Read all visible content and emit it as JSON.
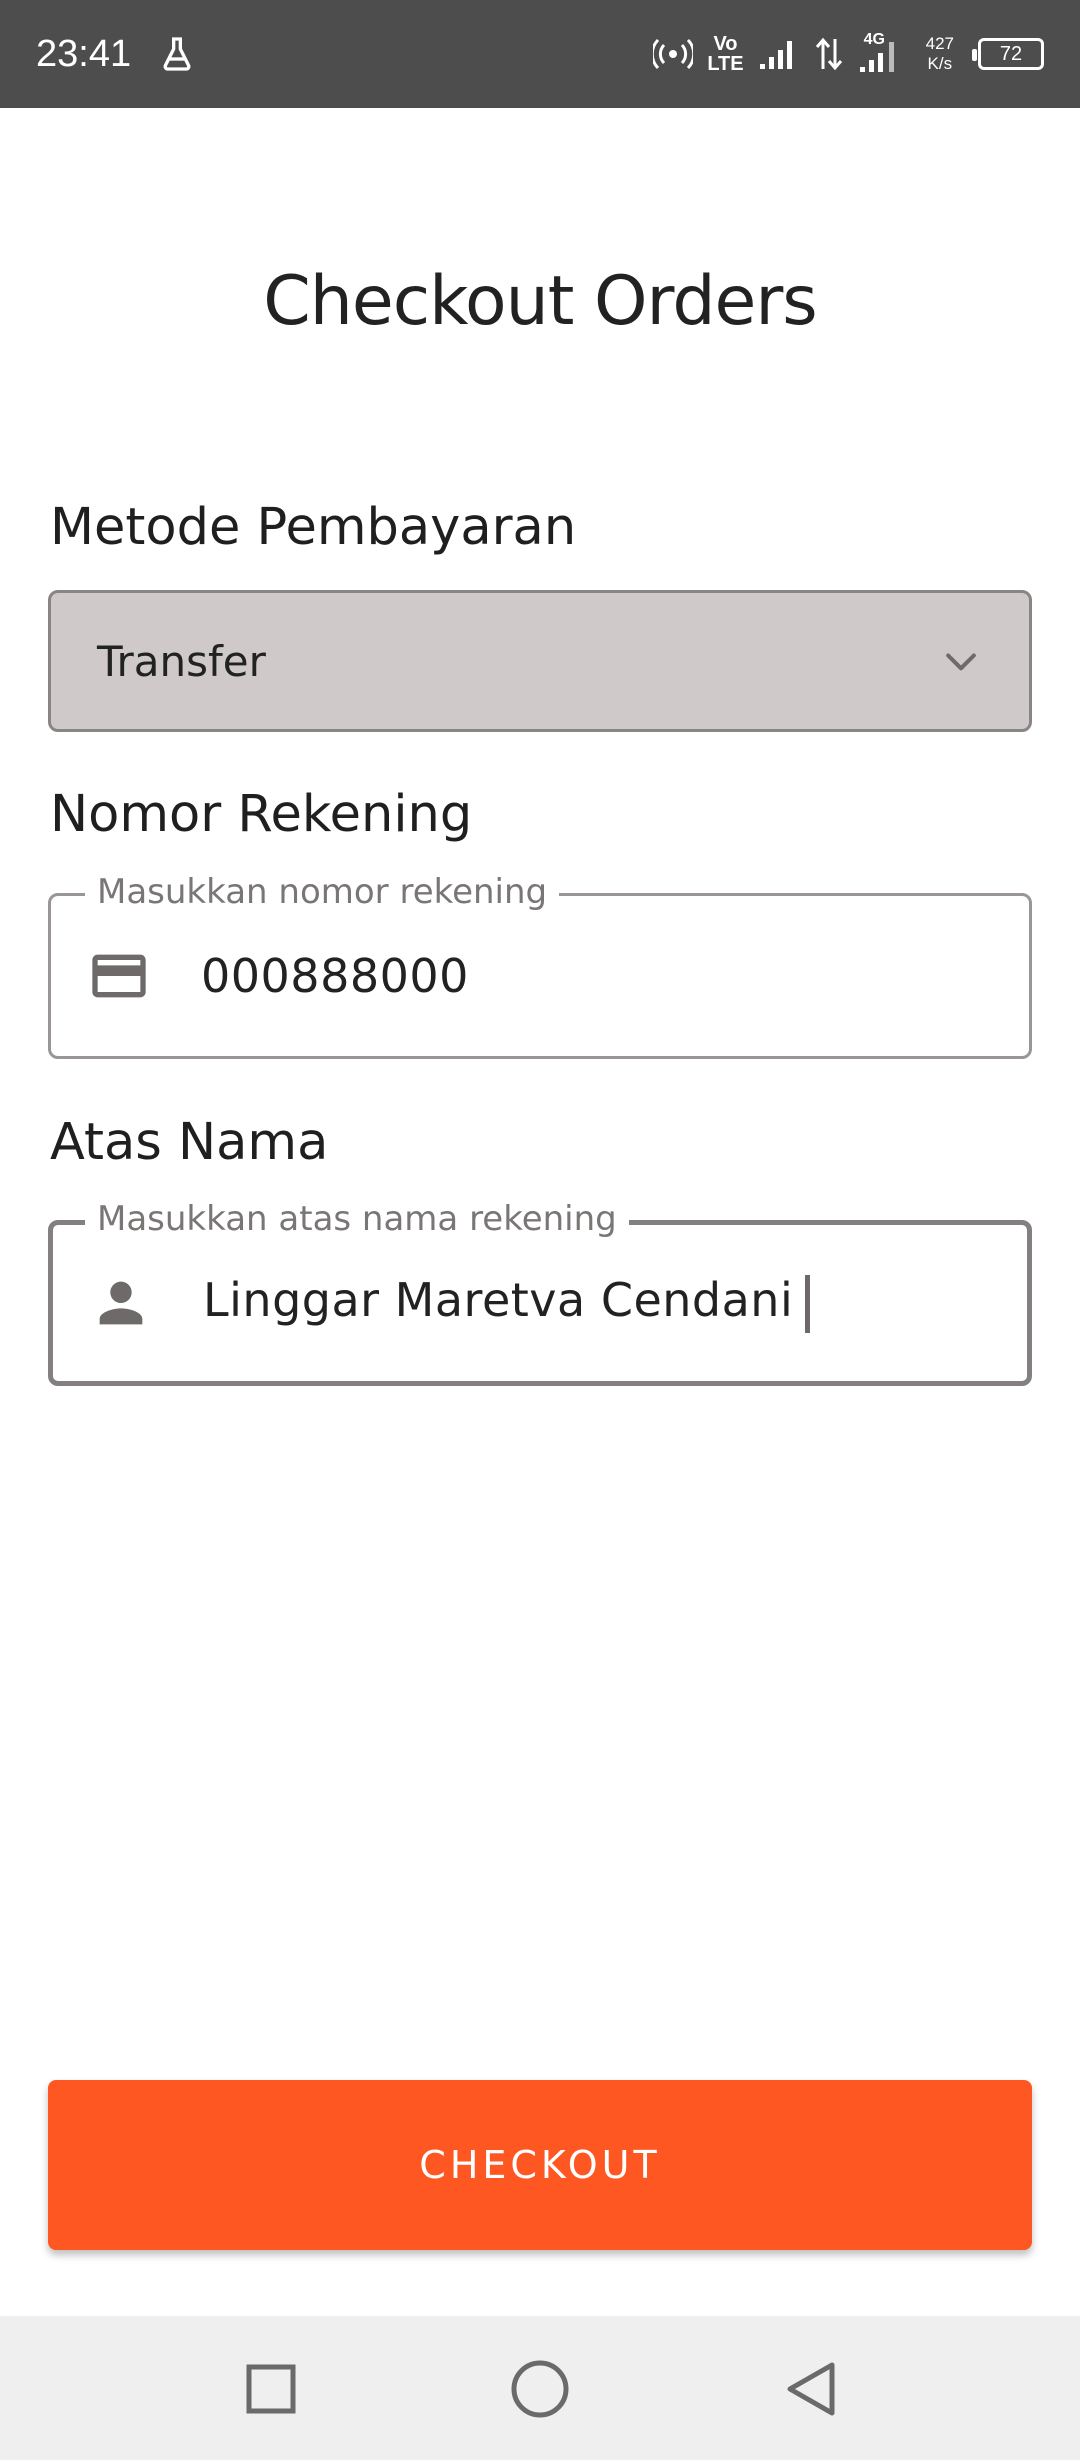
{
  "status_bar": {
    "time": "23:41",
    "network_volte_top": "Vo",
    "network_volte_bottom": "LTE",
    "network_4g": "4G",
    "speed_value": "427",
    "speed_unit": "K/s",
    "battery_level": "72",
    "icons": [
      "lab-flask-icon",
      "hotspot-icon",
      "signal-icon",
      "data-arrows-icon",
      "signal-4g-icon"
    ]
  },
  "page": {
    "title": "Checkout Orders"
  },
  "payment_method": {
    "label": "Metode Pembayaran",
    "selected_value": "Transfer",
    "icon": "chevron-down-icon"
  },
  "account_number": {
    "label": "Nomor Rekening",
    "placeholder": "Masukkan nomor rekening",
    "value": "000888000",
    "icon": "credit-card-icon"
  },
  "account_name": {
    "label": "Atas Nama",
    "placeholder": "Masukkan atas nama rekening",
    "value": "Linggar Maretva Cendani",
    "icon": "person-icon"
  },
  "checkout": {
    "button_label": "CHECKOUT",
    "color": "#ff5722"
  },
  "nav_bar": {
    "icons": [
      "recent-apps-icon",
      "home-icon",
      "back-icon"
    ]
  }
}
